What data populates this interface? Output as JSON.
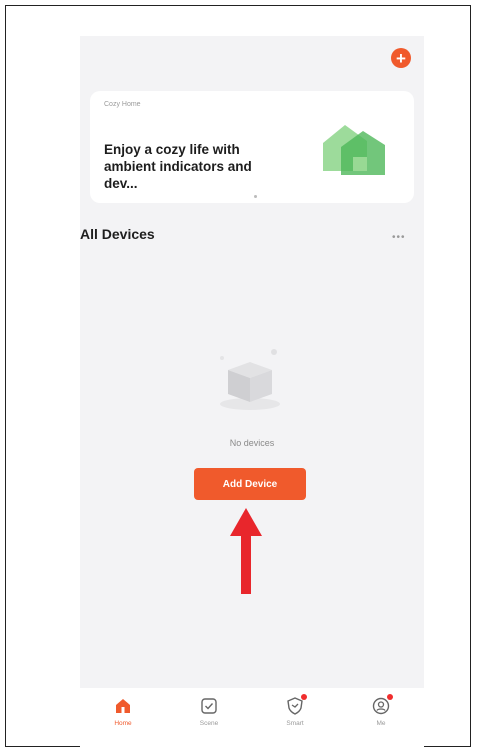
{
  "header": {
    "add_icon": "plus-icon",
    "accent": "#f05a2c"
  },
  "banner": {
    "label": "Cozy Home",
    "headline": "Enjoy a cozy life with ambient indicators and dev...",
    "image": "green-house-illustration"
  },
  "devices": {
    "title": "All Devices",
    "more_icon": "ellipsis-icon",
    "empty_text": "No devices",
    "add_button_label": "Add Device"
  },
  "annotation": {
    "arrow_color": "#e8262c",
    "icon": "up-arrow-icon"
  },
  "tabs": [
    {
      "label": "Home",
      "icon": "home-icon",
      "active": true
    },
    {
      "label": "Scene",
      "icon": "scene-check-icon",
      "active": false
    },
    {
      "label": "Smart",
      "icon": "smart-shield-icon",
      "active": false
    },
    {
      "label": "Me",
      "icon": "profile-icon",
      "active": false
    }
  ]
}
